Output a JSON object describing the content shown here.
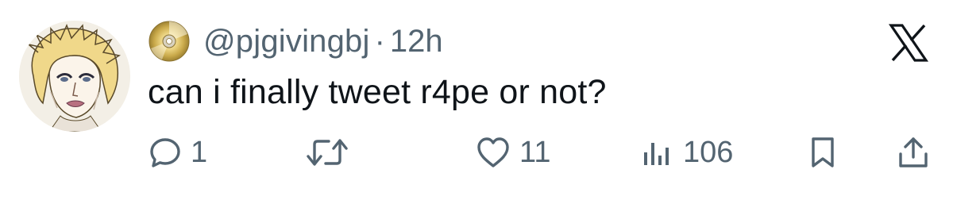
{
  "tweet": {
    "handle": "@pjgivingbj",
    "separator": "·",
    "time": "12h",
    "text": "can i finally tweet r4pe or not?",
    "stats": {
      "replies": "1",
      "retweets": "",
      "likes": "11",
      "views": "106"
    }
  },
  "icons": {
    "avatar": "anime-portrait-avatar",
    "badge": "cd-disc-icon",
    "brand": "x-logo",
    "reply": "reply-icon",
    "retweet": "retweet-icon",
    "like": "heart-icon",
    "views": "views-icon",
    "bookmark": "bookmark-icon",
    "share": "share-icon"
  },
  "colors": {
    "text": "#0f1419",
    "secondary": "#536471",
    "background": "#ffffff"
  }
}
